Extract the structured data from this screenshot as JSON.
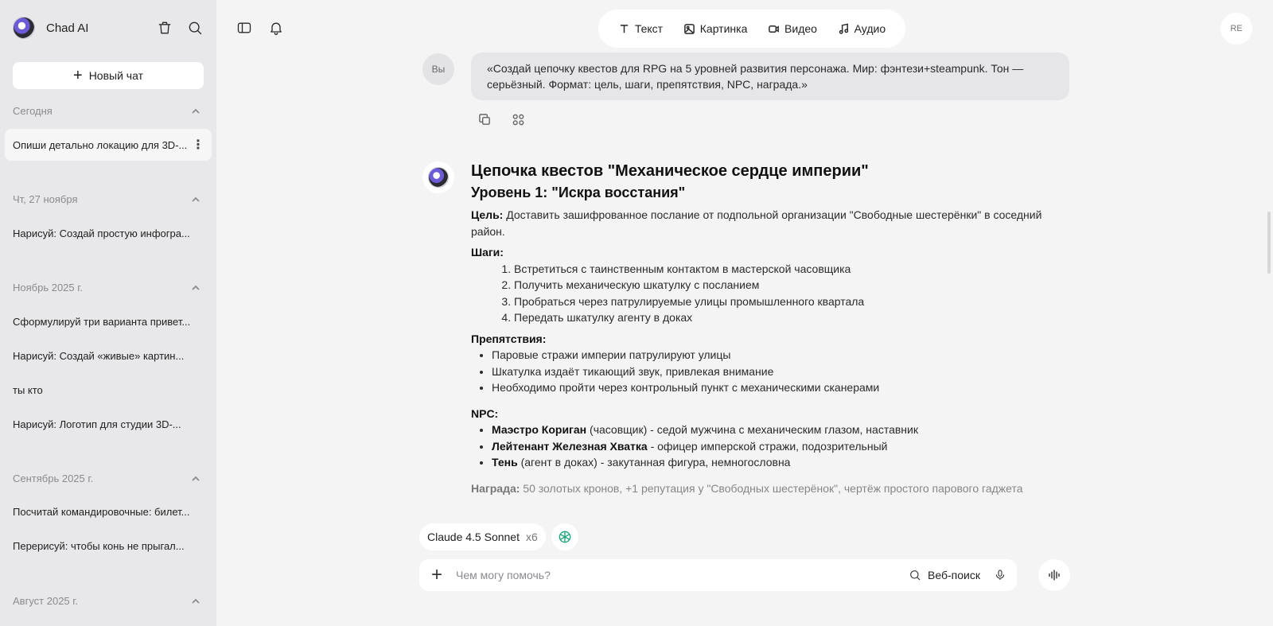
{
  "sidebar": {
    "app_name": "Chad AI",
    "new_chat_label": "Новый чат",
    "sections": [
      {
        "title": "Сегодня",
        "items": [
          "Опиши детально локацию для 3D-..."
        ]
      },
      {
        "title": "Чт, 27 ноября",
        "items": [
          "Нарисуй: Создай простую инфогра..."
        ]
      },
      {
        "title": "Ноябрь 2025 г.",
        "items": [
          "Сформулируй три варианта привет...",
          "Нарисуй: Создай «живые» картин...",
          "ты кто",
          "Нарисуй: Логотип для студии 3D-..."
        ]
      },
      {
        "title": "Сентябрь 2025 г.",
        "items": [
          "Посчитай командировочные: билет...",
          "Перерисуй: чтобы конь не прыгал..."
        ]
      },
      {
        "title": "Август 2025 г.",
        "items": []
      }
    ]
  },
  "topbar": {
    "modes": [
      "Текст",
      "Картинка",
      "Видео",
      "Аудио"
    ],
    "user_initials": "RE"
  },
  "conversation": {
    "user_label": "Вы",
    "user_message": "«Создай цепочку квестов для RPG на 5 уровней развития персонажа. Мир: фэнтези+steampunk. Тон — серьёзный. Формат: цель, шаги, препятствия, NPC, награда.»",
    "answer": {
      "title": "Цепочка квестов \"Механическое сердце империи\"",
      "level_title": "Уровень 1: \"Искра восстания\"",
      "goal_label": "Цель:",
      "goal_text": " Доставить зашифрованное послание от подпольной организации \"Свободные шестерёнки\" в соседний район.",
      "steps_label": "Шаги:",
      "steps": [
        "Встретиться с таинственным контактом в мастерской часовщика",
        "Получить механическую шкатулку с посланием",
        "Пробраться через патрулируемые улицы промышленного квартала",
        "Передать шкатулку агенту в доках"
      ],
      "obstacles_label": "Препятствия:",
      "obstacles": [
        "Паровые стражи империи патрулируют улицы",
        "Шкатулка издаёт тикающий звук, привлекая внимание",
        "Необходимо пройти через контрольный пункт с механическими сканерами"
      ],
      "npc_label": "NPC:",
      "npcs": [
        {
          "name": "Маэстро Кориган",
          "desc": " (часовщик) - седой мужчина с механическим глазом, наставник"
        },
        {
          "name": "Лейтенант Железная Хватка",
          "desc": " - офицер имперской стражи, подозрительный"
        },
        {
          "name": "Тень",
          "desc": " (агент в доках) - закутанная фигура, немногословна"
        }
      ],
      "reward_label": "Награда:",
      "reward_text": " 50 золотых кронов, +1 репутация у \"Свободных шестерёнок\", чертёж простого парового гаджета"
    }
  },
  "composer": {
    "model_name": "Claude 4.5 Sonnet",
    "model_count": "x6",
    "placeholder": "Чем могу помочь?",
    "web_search_label": "Веб-поиск"
  }
}
